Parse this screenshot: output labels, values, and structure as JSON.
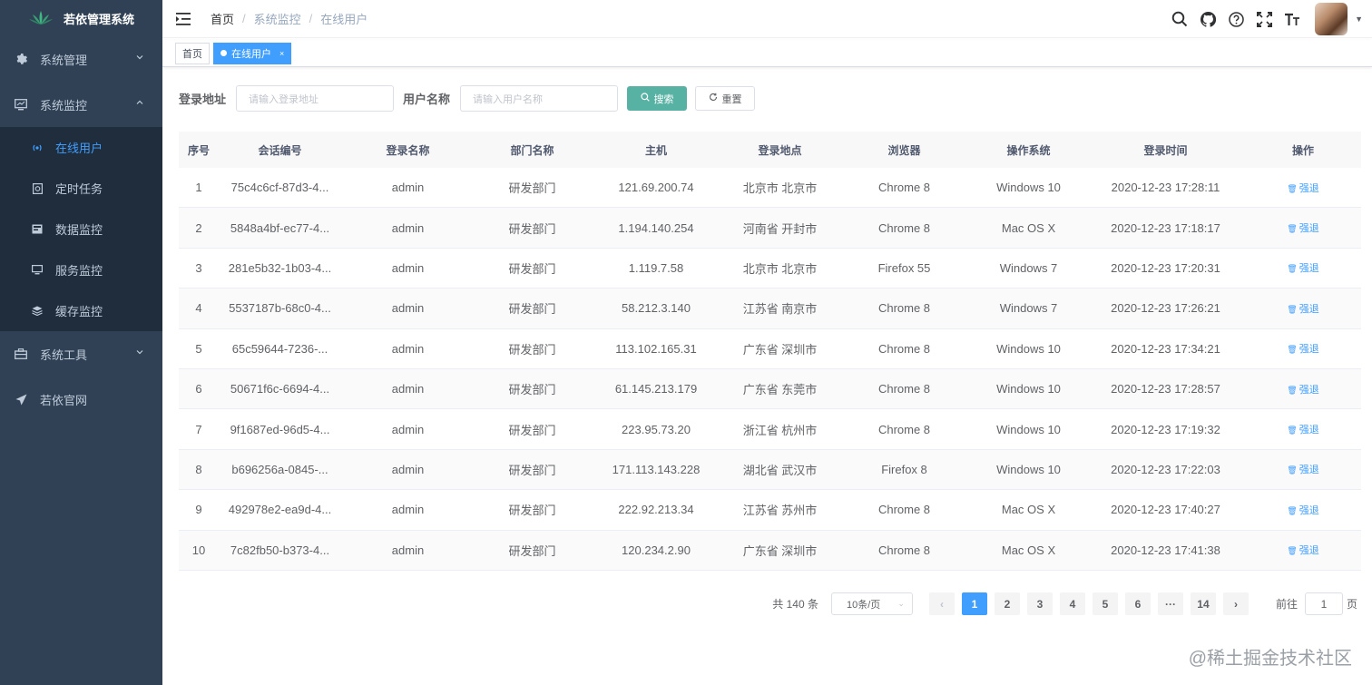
{
  "app": {
    "title": "若依管理系统"
  },
  "sidebar": {
    "items": [
      {
        "label": "系统管理",
        "icon": "gear-icon",
        "expandable": true
      },
      {
        "label": "系统监控",
        "icon": "monitor-icon",
        "expandable": true,
        "expanded": true
      },
      {
        "label": "系统工具",
        "icon": "toolbox-icon",
        "expandable": true
      },
      {
        "label": "若依官网",
        "icon": "paper-plane-icon",
        "expandable": false
      }
    ],
    "monitor_children": [
      {
        "label": "在线用户",
        "icon": "online-icon",
        "active": true
      },
      {
        "label": "定时任务",
        "icon": "job-icon"
      },
      {
        "label": "数据监控",
        "icon": "data-icon"
      },
      {
        "label": "服务监控",
        "icon": "server-icon"
      },
      {
        "label": "缓存监控",
        "icon": "cache-icon"
      }
    ]
  },
  "breadcrumb": [
    "首页",
    "系统监控",
    "在线用户"
  ],
  "tags": [
    {
      "label": "首页",
      "active": false
    },
    {
      "label": "在线用户",
      "active": true,
      "close": "×"
    }
  ],
  "search": {
    "ip_label": "登录地址",
    "ip_placeholder": "请输入登录地址",
    "user_label": "用户名称",
    "user_placeholder": "请输入用户名称",
    "search_btn": "搜索",
    "reset_btn": "重置"
  },
  "table": {
    "columns": [
      "序号",
      "会话编号",
      "登录名称",
      "部门名称",
      "主机",
      "登录地点",
      "浏览器",
      "操作系统",
      "登录时间",
      "操作"
    ],
    "action_label": "强退",
    "rows": [
      [
        "1",
        "75c4c6cf-87d3-4...",
        "admin",
        "研发部门",
        "121.69.200.74",
        "北京市 北京市",
        "Chrome 8",
        "Windows 10",
        "2020-12-23 17:28:11"
      ],
      [
        "2",
        "5848a4bf-ec77-4...",
        "admin",
        "研发部门",
        "1.194.140.254",
        "河南省 开封市",
        "Chrome 8",
        "Mac OS X",
        "2020-12-23 17:18:17"
      ],
      [
        "3",
        "281e5b32-1b03-4...",
        "admin",
        "研发部门",
        "1.119.7.58",
        "北京市 北京市",
        "Firefox 55",
        "Windows 7",
        "2020-12-23 17:20:31"
      ],
      [
        "4",
        "5537187b-68c0-4...",
        "admin",
        "研发部门",
        "58.212.3.140",
        "江苏省 南京市",
        "Chrome 8",
        "Windows 7",
        "2020-12-23 17:26:21"
      ],
      [
        "5",
        "65c59644-7236-...",
        "admin",
        "研发部门",
        "113.102.165.31",
        "广东省 深圳市",
        "Chrome 8",
        "Windows 10",
        "2020-12-23 17:34:21"
      ],
      [
        "6",
        "50671f6c-6694-4...",
        "admin",
        "研发部门",
        "61.145.213.179",
        "广东省 东莞市",
        "Chrome 8",
        "Windows 10",
        "2020-12-23 17:28:57"
      ],
      [
        "7",
        "9f1687ed-96d5-4...",
        "admin",
        "研发部门",
        "223.95.73.20",
        "浙江省 杭州市",
        "Chrome 8",
        "Windows 10",
        "2020-12-23 17:19:32"
      ],
      [
        "8",
        "b696256a-0845-...",
        "admin",
        "研发部门",
        "171.113.143.228",
        "湖北省 武汉市",
        "Firefox 8",
        "Windows 10",
        "2020-12-23 17:22:03"
      ],
      [
        "9",
        "492978e2-ea9d-4...",
        "admin",
        "研发部门",
        "222.92.213.34",
        "江苏省 苏州市",
        "Chrome 8",
        "Mac OS X",
        "2020-12-23 17:40:27"
      ],
      [
        "10",
        "7c82fb50-b373-4...",
        "admin",
        "研发部门",
        "120.234.2.90",
        "广东省 深圳市",
        "Chrome 8",
        "Mac OS X",
        "2020-12-23 17:41:38"
      ]
    ]
  },
  "pagination": {
    "total_text": "共 140 条",
    "page_size": "10条/页",
    "prev": "‹",
    "next": "›",
    "pages": [
      "1",
      "2",
      "3",
      "4",
      "5",
      "6",
      "···",
      "14"
    ],
    "current": "1",
    "goto_prefix": "前往",
    "goto_value": "1",
    "goto_suffix": "页"
  },
  "watermark": "@稀土掘金技术社区",
  "colors": {
    "sidebar_bg": "#304156",
    "submenu_bg": "#1f2d3d",
    "primary": "#409eff",
    "search_btn": "#58b2a4"
  }
}
